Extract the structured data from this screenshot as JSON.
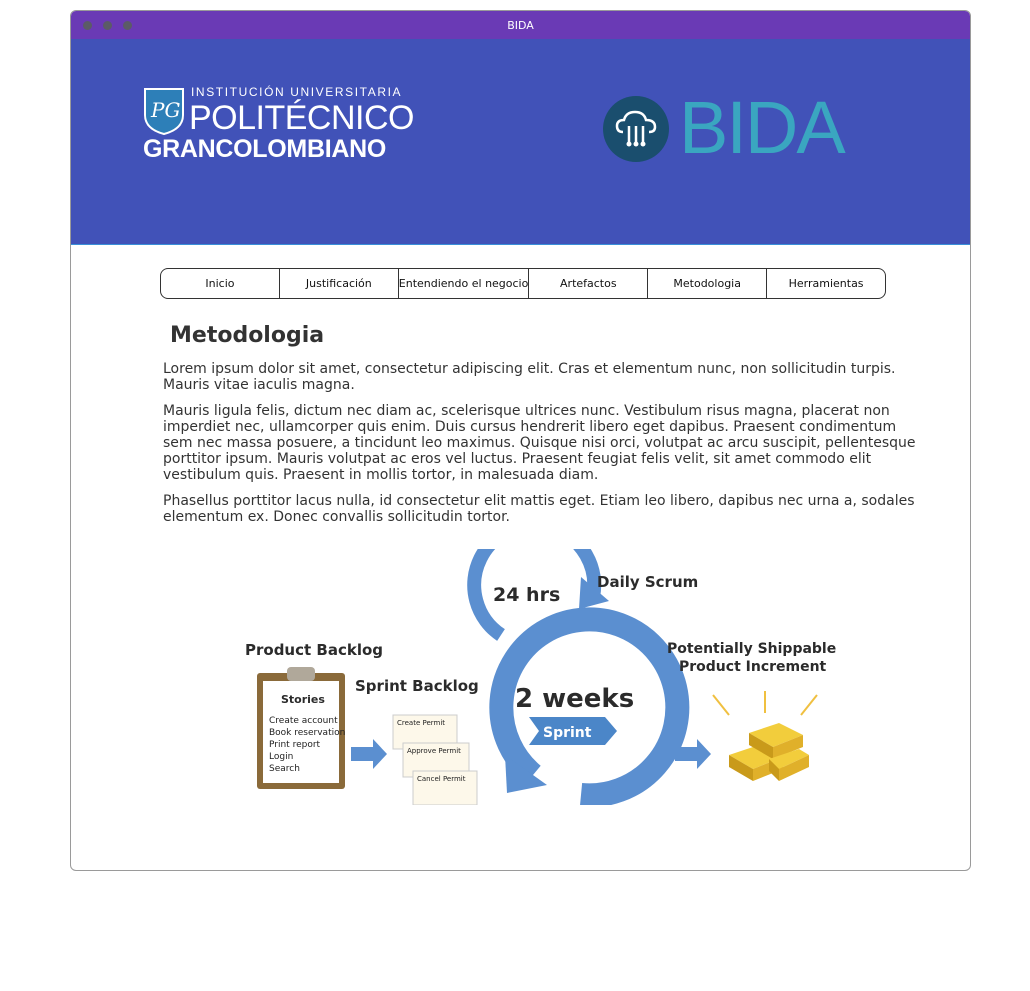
{
  "window": {
    "title": "BIDA"
  },
  "header": {
    "poli_line1": "INSTITUCIÓN UNIVERSITARIA",
    "poli_line2": "POLITÉCNICO",
    "poli_line3": "GRANCOLOMBIANO",
    "bida_name": "BIDA"
  },
  "nav": {
    "items": [
      "Inicio",
      "Justificación",
      "Entendiendo el negocio",
      "Artefactos",
      "Metodologia",
      "Herramientas"
    ]
  },
  "main": {
    "title": "Metodologia",
    "paragraphs": [
      "Lorem ipsum dolor sit amet, consectetur adipiscing elit. Cras et elementum nunc, non sollicitudin turpis. Mauris vitae iaculis magna.",
      "Mauris ligula felis, dictum nec diam ac, scelerisque ultrices nunc. Vestibulum risus magna, placerat non imperdiet nec, ullamcorper quis enim. Duis cursus hendrerit libero eget dapibus. Praesent condimentum sem nec massa posuere, a tincidunt leo maximus. Quisque nisi orci, volutpat ac arcu suscipit, pellentesque porttitor ipsum. Mauris volutpat ac eros vel luctus. Praesent feugiat felis velit, sit amet commodo elit vestibulum quis. Praesent in mollis tortor, in malesuada diam.",
      "Phasellus porttitor lacus nulla, id consectetur elit mattis eget. Etiam leo libero, dapibus nec urna a, sodales elementum ex. Donec convallis sollicitudin tortor."
    ]
  },
  "diagram": {
    "daily_cycle": "24 hrs",
    "daily_label": "Daily Scrum",
    "product_backlog": "Product Backlog",
    "stories_title": "Stories",
    "stories": [
      "Create account",
      "Book reservation",
      "Print report",
      "Login",
      "Search"
    ],
    "sprint_backlog": "Sprint Backlog",
    "sprint_cards": [
      "Create Permit",
      "Approve Permit",
      "Cancel Permit"
    ],
    "sprint_length": "2 weeks",
    "sprint_label": "Sprint",
    "increment_line1": "Potentially Shippable",
    "increment_line2": "Product Increment"
  },
  "colors": {
    "titlebar": "#6a3ab5",
    "banner": "#4152b8",
    "bida_accent": "#3aa6c0",
    "cycle_blue": "#5b8fd0"
  }
}
